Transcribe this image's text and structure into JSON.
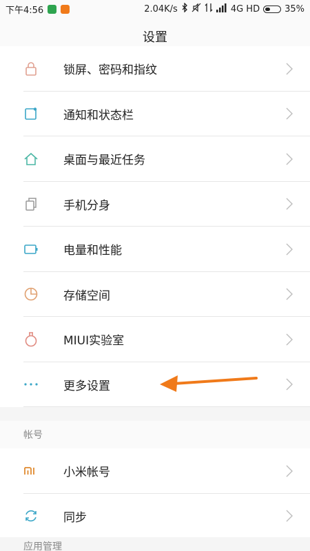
{
  "status_bar": {
    "time": "下午4:56",
    "speed": "2.04K/s",
    "network": "4G HD",
    "battery_pct": "35%",
    "battery_level": 0.35,
    "app_icons": [
      "shield-icon",
      "notification-app-icon"
    ],
    "accent_colors": [
      "#2ea44f",
      "#f07a1a"
    ]
  },
  "header": {
    "title": "设置"
  },
  "items": [
    {
      "label": "锁屏、密码和指纹",
      "icon": "lock-icon"
    },
    {
      "label": "通知和状态栏",
      "icon": "notification-icon"
    },
    {
      "label": "桌面与最近任务",
      "icon": "home-icon"
    },
    {
      "label": "手机分身",
      "icon": "copy-icon"
    },
    {
      "label": "电量和性能",
      "icon": "battery-icon"
    },
    {
      "label": "存储空间",
      "icon": "storage-pie-icon"
    },
    {
      "label": "MIUI实验室",
      "icon": "lab-flask-icon"
    },
    {
      "label": "更多设置",
      "icon": "more-dots-icon"
    }
  ],
  "account_section": {
    "title": "帐号",
    "items": [
      {
        "label": "小米帐号",
        "icon": "mi-logo-icon"
      },
      {
        "label": "同步",
        "icon": "sync-icon"
      }
    ]
  },
  "next_section": {
    "title": "应用管理"
  },
  "annotation": {
    "color": "#f07a1a",
    "points_to": "更多设置"
  },
  "icon_color": "#e0a090"
}
